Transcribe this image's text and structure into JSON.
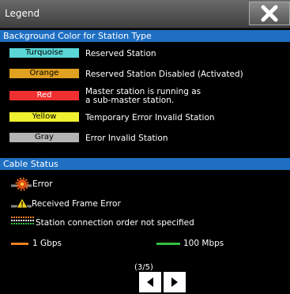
{
  "window": {
    "title": "Legend"
  },
  "background_section": {
    "header": "Background Color for Station Type",
    "rows": [
      {
        "swatch_label": "Turquoise",
        "swatch_color": "#5ad6d6",
        "swatch_text_color": "#000000",
        "description": "Reserved Station"
      },
      {
        "swatch_label": "Orange",
        "swatch_color": "#e0a020",
        "swatch_text_color": "#000000",
        "description": "Reserved Station Disabled (Activated)"
      },
      {
        "swatch_label": "Red",
        "swatch_color": "#f03030",
        "swatch_text_color": "#ffffff",
        "description_line1": "Master station is running as",
        "description_line2": "a sub-master station."
      },
      {
        "swatch_label": "Yellow",
        "swatch_color": "#f0f030",
        "swatch_text_color": "#000000",
        "description": "Temporary Error Invalid Station"
      },
      {
        "swatch_label": "Gray",
        "swatch_color": "#b4b4b4",
        "swatch_text_color": "#000000",
        "description": "Error Invalid Station"
      }
    ]
  },
  "cable_section": {
    "header": "Cable Status",
    "error_label": "Error",
    "received_frame_error_label": "Received Frame Error",
    "order_label": "Station connection order not specified",
    "gbps_label": "1 Gbps",
    "gbps_color": "#f08020",
    "mbps_label": "100 Mbps",
    "mbps_color": "#30c040",
    "error_icon": "gear-error-icon",
    "warning_icon": "warning-triangle-icon"
  },
  "pagination": {
    "indicator": "(3/5)"
  }
}
